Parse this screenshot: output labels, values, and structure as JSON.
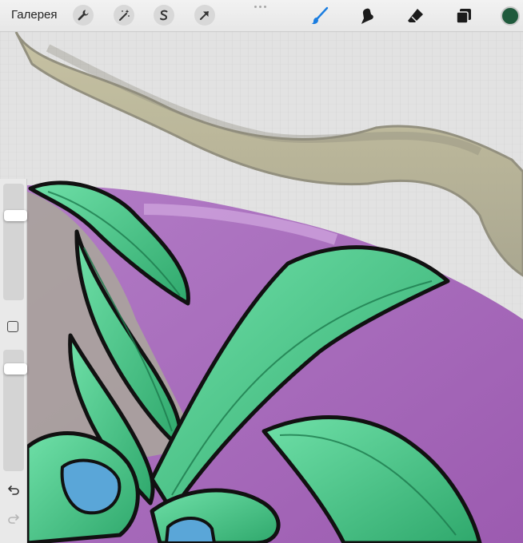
{
  "toolbar": {
    "gallery_label": "Галерея",
    "left_tools": [
      {
        "icon": "wrench-icon"
      },
      {
        "icon": "magic-wand-icon"
      },
      {
        "icon": "selection-s-icon"
      },
      {
        "icon": "arrow-icon"
      }
    ],
    "right_tools": [
      {
        "icon": "brush-icon",
        "active": true
      },
      {
        "icon": "smudge-icon"
      },
      {
        "icon": "eraser-icon"
      },
      {
        "icon": "layers-icon"
      }
    ],
    "active_color": "#1f5a3c",
    "accent_color": "#1a7de0"
  },
  "sidebar": {
    "brush_size": 0.75,
    "opacity": 0.88,
    "modify_icon": "square-icon",
    "undo_icon": "undo-icon",
    "redo_icon": "redo-icon"
  },
  "canvas": {
    "artwork_colors": [
      "#c9c29a",
      "#a566b8",
      "#3fbf80",
      "#5aa6d8"
    ]
  }
}
